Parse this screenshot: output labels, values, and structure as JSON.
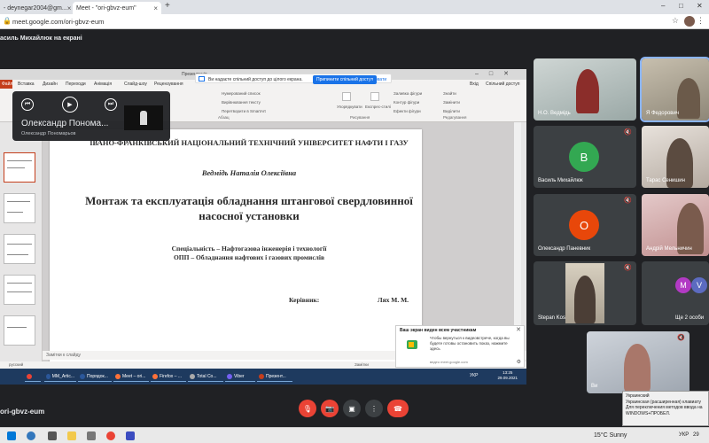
{
  "browser": {
    "tab1_label": "- deynegar2004@gm...",
    "tab2_label": "Meet - \"ori-gbvz-eum\"",
    "new_tab": "+",
    "url": "meet.google.com/ori-gbvz-eum",
    "win_min": "–",
    "win_max": "□",
    "win_close": "✕"
  },
  "meet": {
    "presenter_label": "асиль Михайлюк на екрані",
    "meeting_code": "ori-gbvz-eum"
  },
  "powerpoint": {
    "title": "Презентація",
    "ribbon_tabs": [
      "Файл",
      "Вставка",
      "Дизайн",
      "Переходи",
      "Анімація",
      "Слайд-шоу",
      "Рецензування",
      "Вигляд"
    ],
    "ribbon_right": [
      "Вхід",
      "Спільний доступ"
    ],
    "ribbon_items": [
      "Нумерований список",
      "Вирівнювання тексту",
      "Перетворити в SmartArt",
      "Упорядкувати",
      "Експрес-стилі",
      "Заливка фігури",
      "Контур фігури",
      "Ефекти фігури",
      "Знайти",
      "Замінити",
      "Виділити"
    ],
    "ribbon_groups": [
      "Абзац",
      "Рисування",
      "Редагування"
    ],
    "notes_label": "Замітки к слайду",
    "status_lang": "русский",
    "status_notes": "Замітки"
  },
  "share_notice": {
    "message": "Ви надаєте спільний доступ до цілого екрана.",
    "stop_button": "Припинити спільний доступ",
    "hide_button": "Сховати"
  },
  "slide": {
    "university": "ІВАНО-ФРАНКІВСЬКИЙ НАЦІОНАЛЬНИЙ ТЕХНІЧНИЙ УНІВЕРСИТЕТ НАФТИ І ГАЗУ",
    "author": "Ведмідь Наталія Олексіївна",
    "title": "Монтаж та експлуатація обладнання штангової свердловинної насосної установки",
    "specialty": "Спеціальність – Нафтогазова інженерія і технології",
    "program": "ОПП – Обладнання нафтових і газових промислів",
    "supervisor_label": "Керівник:",
    "supervisor_name": "Лях М. М."
  },
  "mini_player": {
    "name": "Олександр Понома...",
    "subtitle": "Олександр Пономарьов"
  },
  "notification": {
    "title": "Ваш экран виден всем участникам",
    "body": "Чтобы вернуться к видеовстрече, когда вы будете готовы остановить показ, нажмите здесь",
    "source": "ведео meet.google.com",
    "close": "✕"
  },
  "inner_taskbar": {
    "items": [
      "MM_Artic...",
      "Порядок...",
      "Meet – ori...",
      "Firefox – ...",
      "Total Co...",
      "Viber",
      "Презент..."
    ],
    "lang": "УКР",
    "time": "13:25",
    "date": "29.09.2021"
  },
  "participants": [
    {
      "name": "Н.О. Ведмідь",
      "type": "video"
    },
    {
      "name": "Я Федорович",
      "type": "video"
    },
    {
      "name": "Василь Михайлюк",
      "initial": "В",
      "color": "#33a852",
      "type": "avatar"
    },
    {
      "name": "Тарас Сенишин",
      "type": "video"
    },
    {
      "name": "Олександр Паневник",
      "initial": "О",
      "color": "#e8470a",
      "type": "avatar"
    },
    {
      "name": "Андрій Мельничин",
      "type": "video"
    },
    {
      "name": "Stepan Kos",
      "type": "video"
    },
    {
      "name": "Ще 2 особи",
      "type": "group",
      "initials": [
        "M",
        "V"
      ]
    },
    {
      "name": "Ви",
      "type": "video"
    }
  ],
  "language_popup": {
    "line1": "Украинский",
    "line2": "Украинская (расширенная) клавиату",
    "line3": "Для переключения методов ввода на",
    "line4": "WINDOWS+ПРОБЕЛ."
  },
  "taskbar": {
    "weather": "15°C Sunny",
    "lang": "УКР",
    "time": "29"
  },
  "colors": {
    "meet_bg": "#202124",
    "end_call": "#ea4335",
    "mic_off": "#ea4335",
    "ppt_accent": "#c43e1c"
  }
}
